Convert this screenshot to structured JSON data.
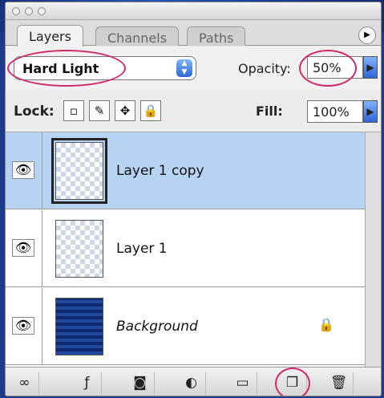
{
  "tabs": [
    {
      "label": "Layers"
    },
    {
      "label": "Channels"
    },
    {
      "label": "Paths"
    }
  ],
  "blend": {
    "mode": "Hard Light"
  },
  "opacity": {
    "label": "Opacity:",
    "value": "50%"
  },
  "lock": {
    "label": "Lock:"
  },
  "fill": {
    "label": "Fill:",
    "value": "100%"
  },
  "layers": [
    {
      "name": "Layer 1 copy",
      "selected": true
    },
    {
      "name": "Layer 1",
      "selected": false
    },
    {
      "name": "Background",
      "selected": false,
      "locked": true
    }
  ],
  "icons": {
    "eye": "eye-icon",
    "lock": "lock-icon",
    "link": "link-icon",
    "fx": "layer-style-icon",
    "mask": "mask-icon",
    "adjust": "adjustment-layer-icon",
    "folder": "folder-icon",
    "new": "new-layer-icon",
    "trash": "trash-icon"
  },
  "colors": {
    "selection": "#b7d3f2",
    "highlight": "#d02a6a",
    "accent": "#2e66d8"
  }
}
